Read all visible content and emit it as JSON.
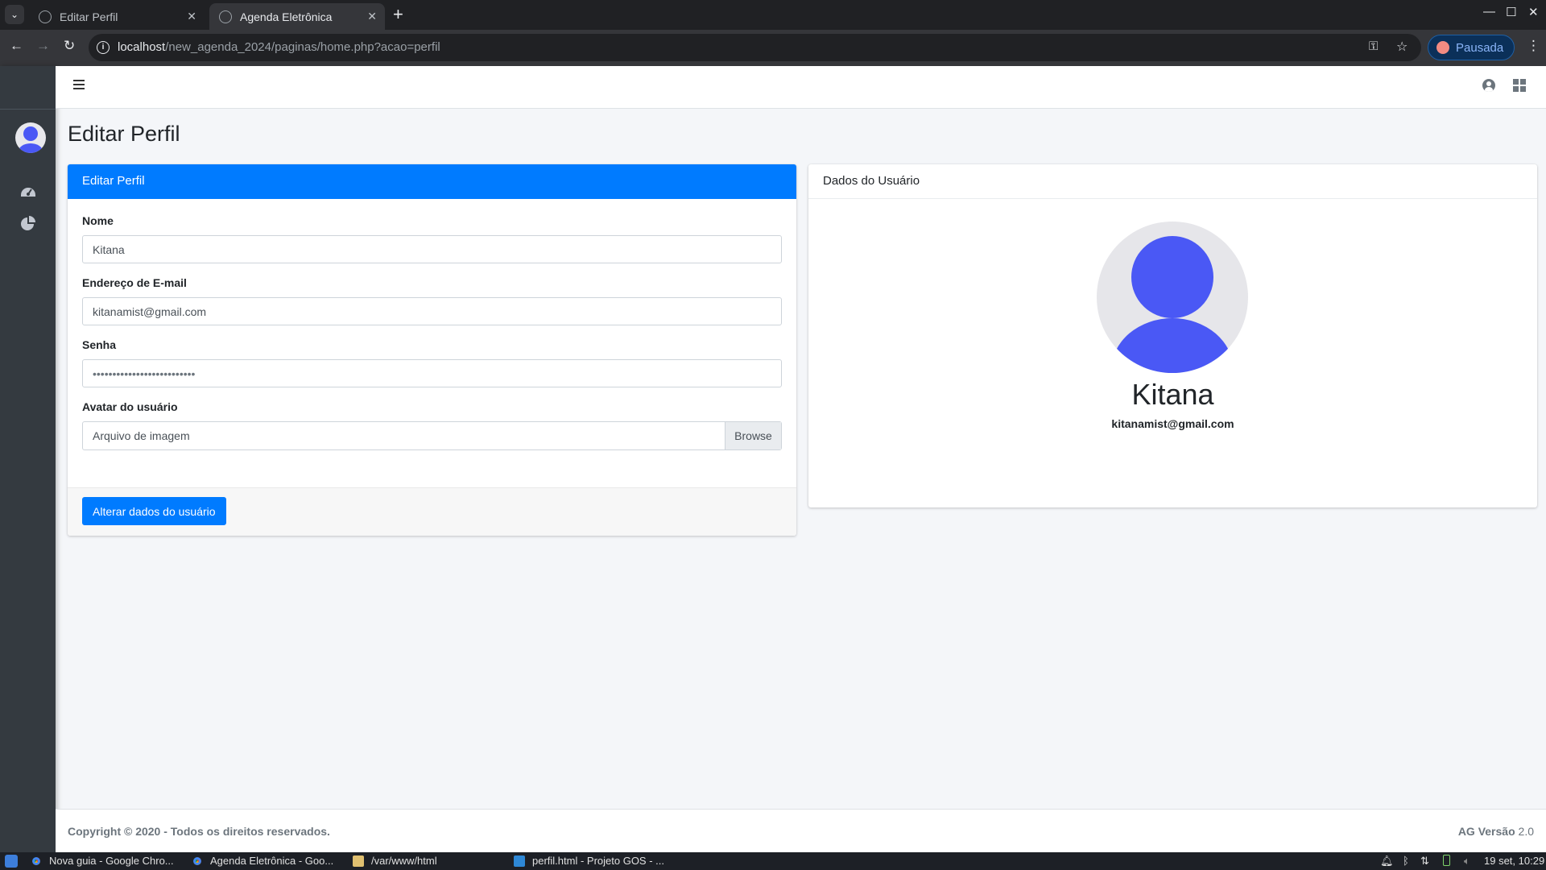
{
  "browser": {
    "tabs": [
      {
        "title": "Editar Perfil",
        "active": false
      },
      {
        "title": "Agenda Eletrônica",
        "active": true
      }
    ],
    "url_host": "localhost",
    "url_path": "/new_agenda_2024/paginas/home.php?acao=perfil",
    "profile_chip": "Pausada"
  },
  "page": {
    "title": "Editar Perfil",
    "edit_card": {
      "header": "Editar Perfil",
      "name_label": "Nome",
      "name_value": "Kitana",
      "email_label": "Endereço de E-mail",
      "email_value": "kitanamist@gmail.com",
      "password_label": "Senha",
      "password_value": "••••••••••••••••••••••••••",
      "avatar_label": "Avatar do usuário",
      "avatar_placeholder": "Arquivo de imagem",
      "browse_label": "Browse",
      "submit_label": "Alterar dados do usuário"
    },
    "user_card": {
      "header": "Dados do Usuário",
      "name": "Kitana",
      "email": "kitanamist@gmail.com"
    },
    "footer": {
      "copyright": "Copyright © 2020 - Todos os direitos reservados.",
      "version_label": "AG Versão",
      "version_number": "2.0"
    }
  },
  "taskbar": {
    "items": [
      {
        "label": "Nova guia - Google Chro...",
        "icon": "chrome-icon"
      },
      {
        "label": "Agenda Eletrônica - Goo...",
        "icon": "chrome-icon"
      },
      {
        "label": "/var/www/html",
        "icon": "folder-icon"
      },
      {
        "label": "perfil.html - Projeto GOS - ...",
        "icon": "vscode-icon"
      }
    ],
    "clock": "19 set, 10:29"
  },
  "colors": {
    "primary": "#007bff",
    "sidebar": "#343a40",
    "avatar": "#4a58f5"
  }
}
